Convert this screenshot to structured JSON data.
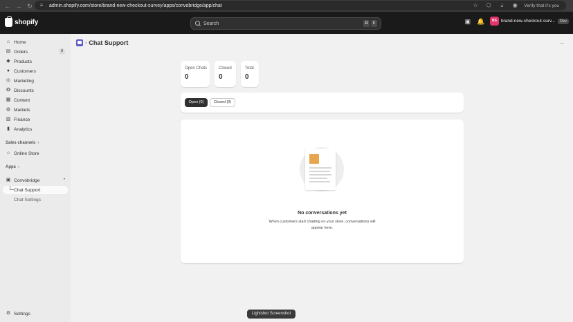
{
  "browser": {
    "url": "admin.shopify.com/store/brand-new-checkout-survey/apps/convobridge/app/chat",
    "verify_text": "Verify that it's you"
  },
  "topbar": {
    "logo_text": "shopify",
    "search_placeholder": "Search",
    "shortcut_keys": [
      "⌘",
      "K"
    ],
    "store_initials": "BS",
    "store_name": "brand-new-checkout-surv...",
    "dev_badge": "Dev"
  },
  "sidebar": {
    "items": [
      {
        "label": "Home",
        "icon": "home-icon"
      },
      {
        "label": "Orders",
        "icon": "orders-icon",
        "badge": "8"
      },
      {
        "label": "Products",
        "icon": "tag-icon"
      },
      {
        "label": "Customers",
        "icon": "person-icon"
      },
      {
        "label": "Marketing",
        "icon": "target-icon"
      },
      {
        "label": "Discounts",
        "icon": "discount-icon"
      },
      {
        "label": "Content",
        "icon": "content-icon"
      },
      {
        "label": "Markets",
        "icon": "globe-icon"
      },
      {
        "label": "Finance",
        "icon": "bank-icon"
      },
      {
        "label": "Analytics",
        "icon": "chart-icon"
      }
    ],
    "sales_channels_label": "Sales channels",
    "online_store_label": "Online Store",
    "apps_label": "Apps",
    "app_name": "Convobridge",
    "sub_items": [
      {
        "label": "Chat Support"
      },
      {
        "label": "Chat Settings"
      }
    ],
    "settings_label": "Settings"
  },
  "page": {
    "title": "Chat Support",
    "stats": [
      {
        "label": "Open Chats",
        "value": "0"
      },
      {
        "label": "Closed",
        "value": "0"
      },
      {
        "label": "Total",
        "value": "0"
      }
    ],
    "tabs": [
      {
        "label": "Open (0)"
      },
      {
        "label": "Closed (0)"
      }
    ],
    "empty_title": "No conversations yet",
    "empty_desc": "When customers start chatting on your store, conversations will appear here."
  },
  "tooltip": "Lightshot Screenshot"
}
